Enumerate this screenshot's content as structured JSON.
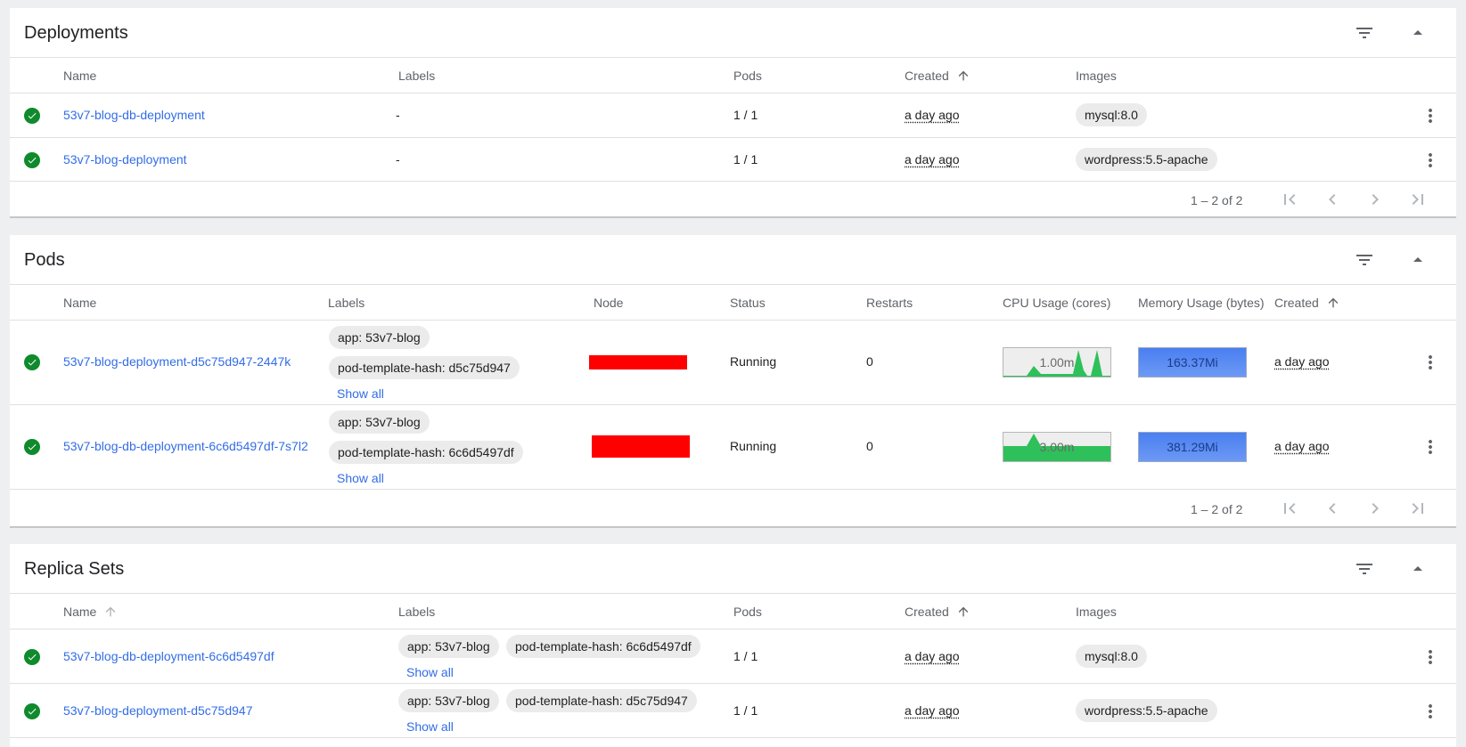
{
  "deployments": {
    "title": "Deployments",
    "columns": {
      "name": "Name",
      "labels": "Labels",
      "pods": "Pods",
      "created": "Created",
      "images": "Images"
    },
    "rows": [
      {
        "name": "53v7-blog-db-deployment",
        "labels": "-",
        "pods": "1 / 1",
        "created": "a day ago",
        "image": "mysql:8.0"
      },
      {
        "name": "53v7-blog-deployment",
        "labels": "-",
        "pods": "1 / 1",
        "created": "a day ago",
        "image": "wordpress:5.5-apache"
      }
    ],
    "range": "1 – 2 of 2"
  },
  "pods": {
    "title": "Pods",
    "columns": {
      "name": "Name",
      "labels": "Labels",
      "node": "Node",
      "status": "Status",
      "restarts": "Restarts",
      "cpu": "CPU Usage (cores)",
      "memory": "Memory Usage (bytes)",
      "created": "Created"
    },
    "rows": [
      {
        "name": "53v7-blog-deployment-d5c75d947-2447k",
        "label_app": "app: 53v7-blog",
        "label_hash": "pod-template-hash: d5c75d947",
        "show_all": "Show all",
        "status": "Running",
        "restarts": "0",
        "cpu": "1.00m",
        "memory": "163.37Mi",
        "created": "a day ago"
      },
      {
        "name": "53v7-blog-db-deployment-6c6d5497df-7s7l2",
        "label_app": "app: 53v7-blog",
        "label_hash": "pod-template-hash: 6c6d5497df",
        "show_all": "Show all",
        "status": "Running",
        "restarts": "0",
        "cpu": "3.00m",
        "memory": "381.29Mi",
        "created": "a day ago"
      }
    ],
    "range": "1 – 2 of 2"
  },
  "replicasets": {
    "title": "Replica Sets",
    "columns": {
      "name": "Name",
      "labels": "Labels",
      "pods": "Pods",
      "created": "Created",
      "images": "Images"
    },
    "rows": [
      {
        "name": "53v7-blog-db-deployment-6c6d5497df",
        "label_app": "app: 53v7-blog",
        "label_hash": "pod-template-hash: 6c6d5497df",
        "show_all": "Show all",
        "pods": "1 / 1",
        "created": "a day ago",
        "image": "mysql:8.0"
      },
      {
        "name": "53v7-blog-deployment-d5c75d947",
        "label_app": "app: 53v7-blog",
        "label_hash": "pod-template-hash: d5c75d947",
        "show_all": "Show all",
        "pods": "1 / 1",
        "created": "a day ago",
        "image": "wordpress:5.5-apache"
      }
    ]
  },
  "colors": {
    "link": "#326de6",
    "ok": "#0f8a2c",
    "cpu_fill": "#2ec05a",
    "memory_fill": "#4a7ff0",
    "redaction": "#ff0000"
  }
}
